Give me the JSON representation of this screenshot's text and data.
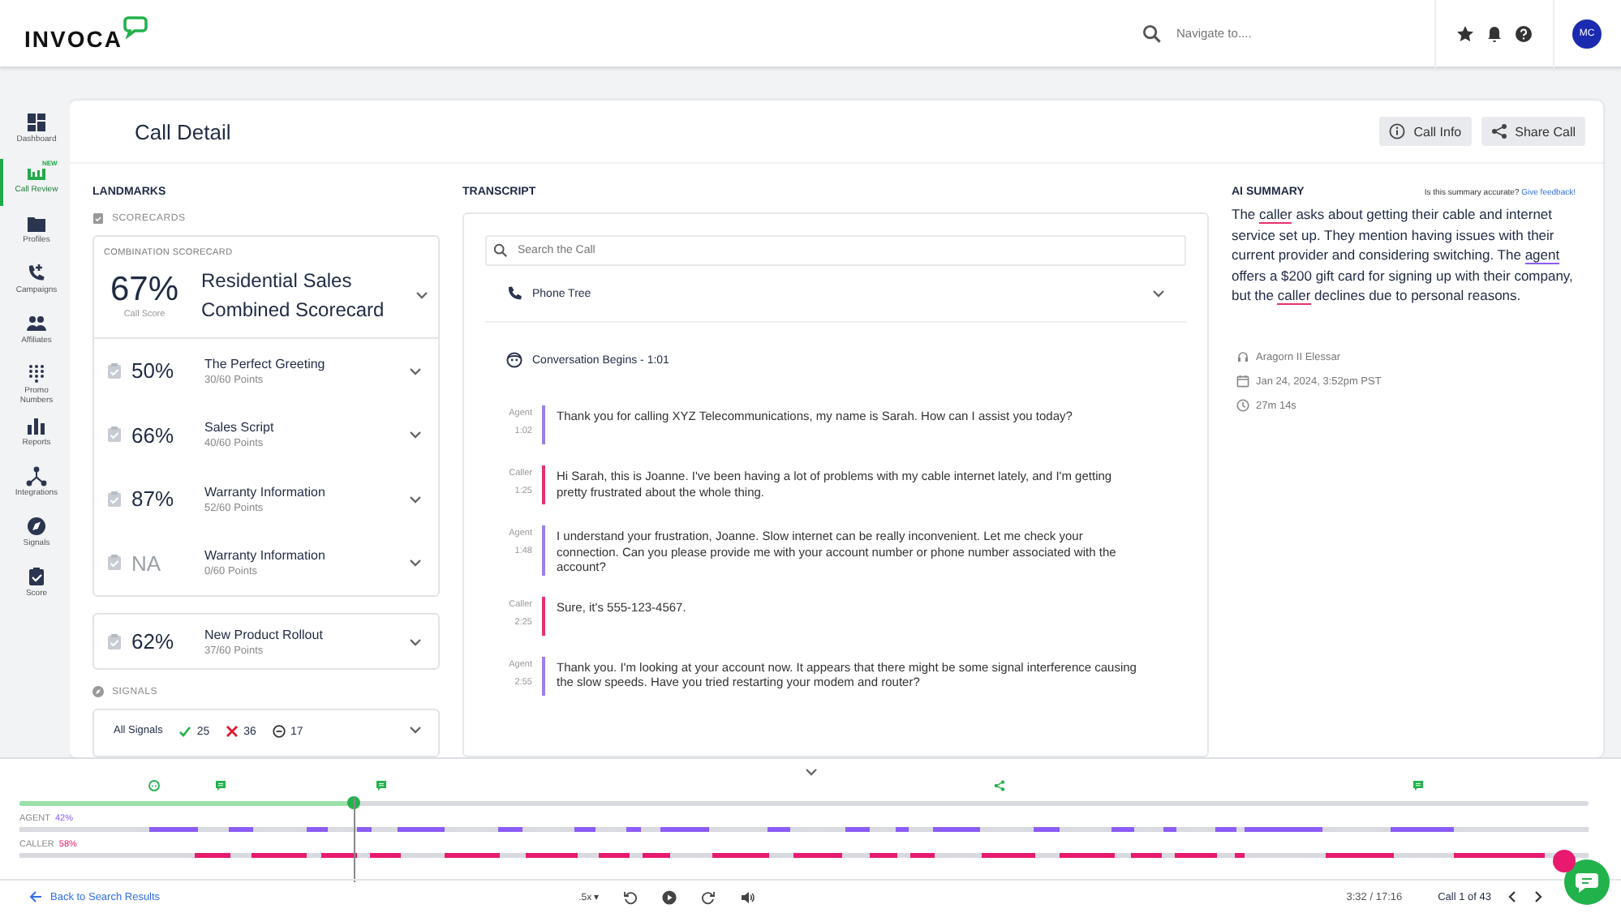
{
  "header": {
    "logo": "INVOCA",
    "search": {
      "placeholder": "Navigate to...."
    },
    "avatar": "MC"
  },
  "sidebar": {
    "items": [
      {
        "label": "Dashboard",
        "selected": false
      },
      {
        "label": "Call Review",
        "selected": true,
        "badge": "NEW"
      },
      {
        "label": "Profiles",
        "selected": false
      },
      {
        "label": "Campaigns",
        "selected": false
      },
      {
        "label": "Affiliates",
        "selected": false
      },
      {
        "label": "Promo Numbers",
        "selected": false
      },
      {
        "label": "Reports",
        "selected": false
      },
      {
        "label": "Integrations",
        "selected": false
      },
      {
        "label": "Signals",
        "selected": false
      },
      {
        "label": "Score",
        "selected": false
      }
    ]
  },
  "page": {
    "title": "Call Detail",
    "buttons": [
      {
        "kind": "info",
        "label": "Call Info"
      },
      {
        "kind": "share",
        "label": "Share Call"
      }
    ]
  },
  "landmarks": {
    "heading": "LANDMARKS",
    "scorecards_label": "SCORECARDS",
    "combination": {
      "label": "COMBINATION SCORECARD",
      "score": "67%",
      "score_label": "Call Score",
      "name": "Residential Sales Combined Scorecard"
    },
    "scorecards": [
      {
        "score": "50%",
        "name": "The Perfect Greeting",
        "points": "30/60 Points",
        "muted": false
      },
      {
        "score": "66%",
        "name": "Sales Script",
        "points": "40/60 Points",
        "muted": false
      },
      {
        "score": "87%",
        "name": "Warranty Information",
        "points": "52/60 Points",
        "muted": false
      },
      {
        "score": "NA",
        "name": "Warranty Information",
        "points": "0/60 Points",
        "muted": true
      }
    ],
    "extra_scorecards": [
      {
        "score": "62%",
        "name": "New Product Rollout",
        "points": "37/60 Points",
        "muted": false
      }
    ],
    "signals_label": "SIGNALS",
    "signals": {
      "label": "All Signals",
      "counts": [
        {
          "kind": "positive",
          "value": "25"
        },
        {
          "kind": "negative",
          "value": "36"
        },
        {
          "kind": "neutral",
          "value": "17"
        }
      ]
    }
  },
  "transcript": {
    "heading": "TRANSCRIPT",
    "search": {
      "placeholder": "Search the Call"
    },
    "phone_tree": "Phone Tree",
    "conversation_start": "Conversation Begins - 1:01",
    "messages": [
      {
        "kind": "agent",
        "speaker": "Agent",
        "time": "1:02",
        "text": "Thank you for calling XYZ Telecommunications, my name is Sarah. How can I assist you today?"
      },
      {
        "kind": "caller",
        "speaker": "Caller",
        "time": "1:25",
        "text": "Hi Sarah, this is Joanne. I've been having a lot of problems with my cable internet lately, and I'm getting pretty frustrated about the whole thing."
      },
      {
        "kind": "agent",
        "speaker": "Agent",
        "time": "1:48",
        "text": "I understand your frustration, Joanne. Slow internet can be really inconvenient. Let me check your connection. Can you please provide me with your account number or phone number associated with the account?"
      },
      {
        "kind": "caller",
        "speaker": "Caller",
        "time": "2:25",
        "text": "Sure, it's 555-123-4567."
      },
      {
        "kind": "agent",
        "speaker": "Agent",
        "time": "2:55",
        "text": "Thank you. I'm looking at your account now. It appears that there might be some signal interference causing the slow speeds. Have you tried restarting your modem and router?"
      }
    ]
  },
  "summary": {
    "heading": "AI SUMMARY",
    "question": "Is this summary accurate?",
    "feedback_link": "Give feedback!",
    "parts": [
      {
        "kind": "plain",
        "text": "The "
      },
      {
        "kind": "caller",
        "text": "caller"
      },
      {
        "kind": "plain",
        "text": " asks about getting their cable and internet service set up. They mention having issues with their current provider and considering switching. The "
      },
      {
        "kind": "agent",
        "text": "agent"
      },
      {
        "kind": "plain",
        "text": " offers a $200 gift card for signing up with their company, but the "
      },
      {
        "kind": "caller",
        "text": "caller"
      },
      {
        "kind": "plain",
        "text": " declines due to personal reasons."
      }
    ],
    "meta": [
      {
        "kind": "agent",
        "text": "Aragorn II Elessar"
      },
      {
        "kind": "date",
        "text": "Jan 24, 2024, 3:52pm PST"
      },
      {
        "kind": "duration",
        "text": "27m 14s"
      }
    ]
  },
  "timeline": {
    "level": 0.213,
    "agent_label": "AGENT",
    "agent_share": "42%",
    "caller_label": "CALLER",
    "caller_share": "58%"
  },
  "footer": {
    "back": "Back to Search Results",
    "speed": ".5x ▾",
    "time": "3:32 / 17:16",
    "call_position": "Call 1 of 43"
  }
}
